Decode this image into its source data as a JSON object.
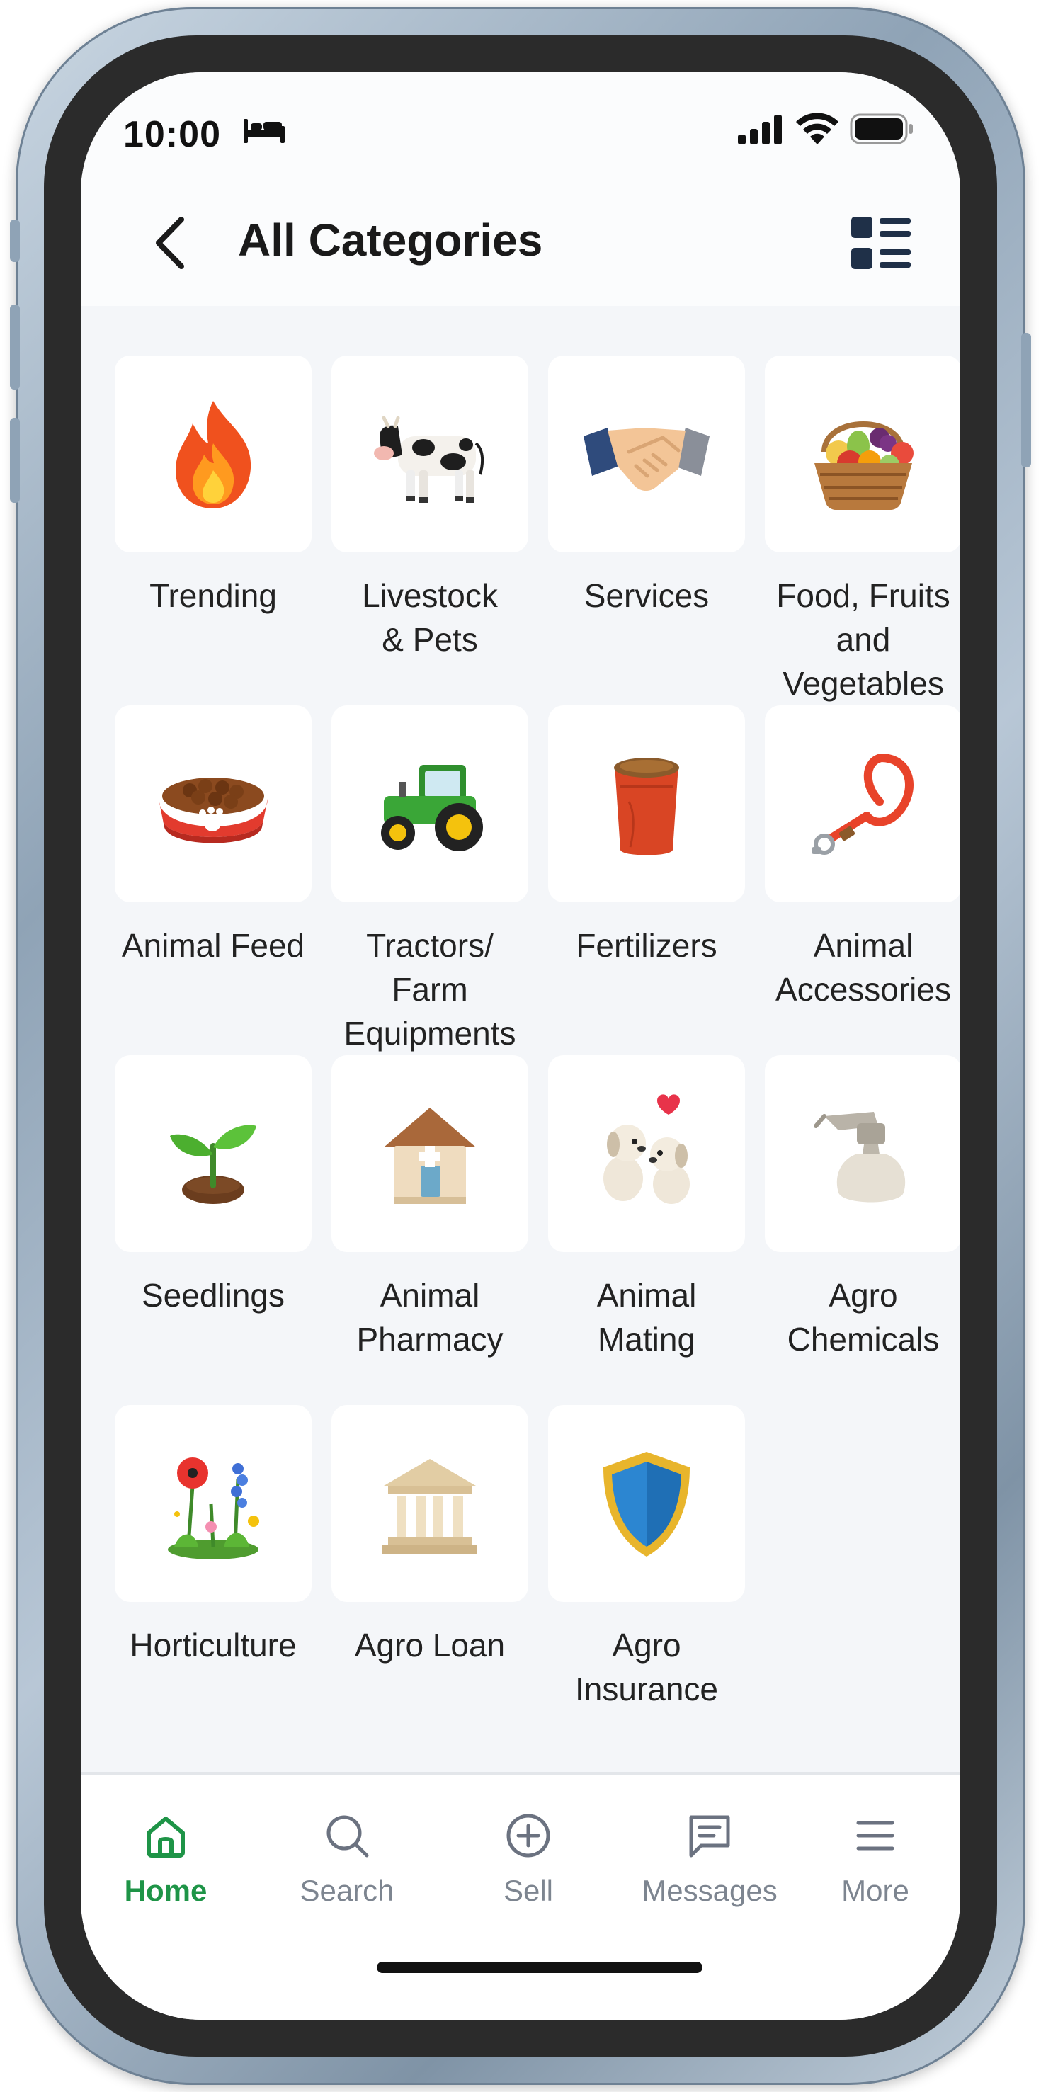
{
  "status_bar": {
    "time": "10:00"
  },
  "header": {
    "title": "All Categories"
  },
  "categories": [
    {
      "label": "Trending",
      "icon": "fire-icon"
    },
    {
      "label": "Livestock\n& Pets",
      "icon": "cow-icon"
    },
    {
      "label": "Services",
      "icon": "handshake-icon"
    },
    {
      "label": "Food, Fruits\nand\nVegetables",
      "icon": "fruit-basket-icon"
    },
    {
      "label": "Animal Feed",
      "icon": "pet-food-bowl-icon"
    },
    {
      "label": "Tractors/\nFarm\nEquipments",
      "icon": "tractor-icon"
    },
    {
      "label": "Fertilizers",
      "icon": "fertilizer-sack-icon"
    },
    {
      "label": "Animal\nAccessories",
      "icon": "leash-icon"
    },
    {
      "label": "Seedlings",
      "icon": "seedling-icon"
    },
    {
      "label": "Animal\nPharmacy",
      "icon": "pharmacy-house-icon"
    },
    {
      "label": "Animal\nMating",
      "icon": "dogs-heart-icon"
    },
    {
      "label": "Agro\nChemicals",
      "icon": "spray-bottle-icon"
    },
    {
      "label": "Horticulture",
      "icon": "flowers-icon"
    },
    {
      "label": "Agro Loan",
      "icon": "bank-icon"
    },
    {
      "label": "Agro\nInsurance",
      "icon": "shield-icon"
    }
  ],
  "bottom_nav": [
    {
      "label": "Home",
      "icon": "home-icon",
      "active": true
    },
    {
      "label": "Search",
      "icon": "search-icon",
      "active": false
    },
    {
      "label": "Sell",
      "icon": "plus-circle-icon",
      "active": false
    },
    {
      "label": "Messages",
      "icon": "message-icon",
      "active": false
    },
    {
      "label": "More",
      "icon": "menu-icon",
      "active": false
    }
  ],
  "colors": {
    "accent": "#1e9447",
    "inactive_nav": "#7d8590",
    "screen_bg": "#f4f6f9",
    "tile_bg": "#ffffff"
  }
}
